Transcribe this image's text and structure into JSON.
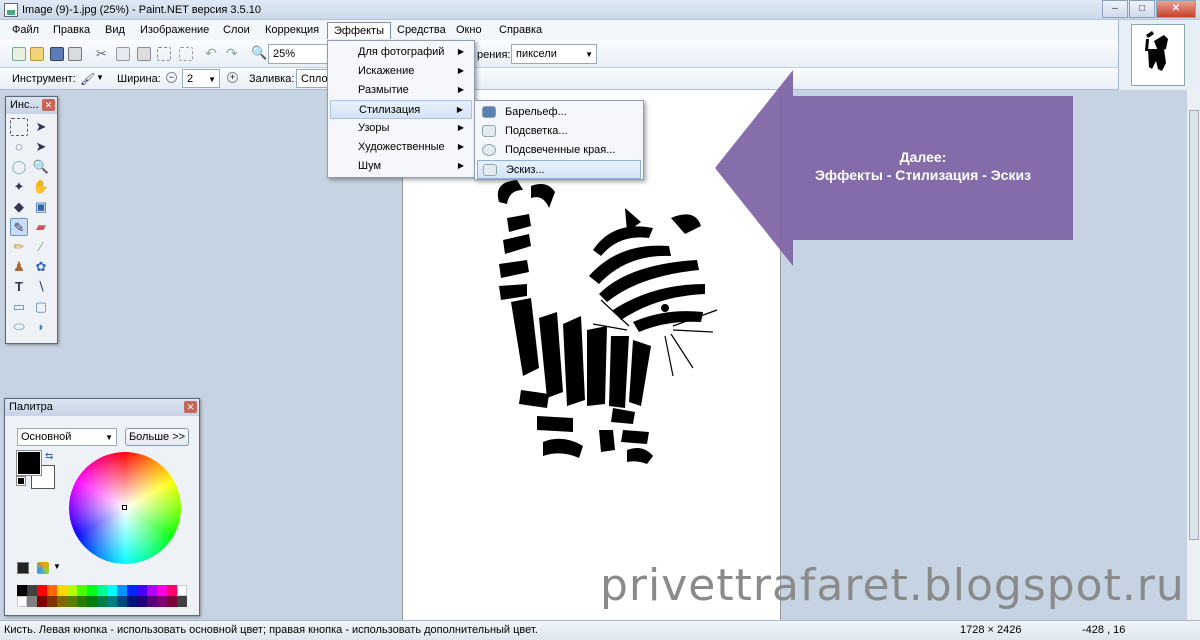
{
  "window": {
    "title": "Image (9)-1.jpg (25%) - Paint.NET версия 3.5.10",
    "min": "–",
    "max": "□",
    "close": "✕"
  },
  "menubar": [
    {
      "label": "Файл"
    },
    {
      "label": "Правка"
    },
    {
      "label": "Вид"
    },
    {
      "label": "Изображение"
    },
    {
      "label": "Слои"
    },
    {
      "label": "Коррекция"
    },
    {
      "label": "Эффекты"
    },
    {
      "label": "Средства"
    },
    {
      "label": "Окно"
    },
    {
      "label": "Справка"
    }
  ],
  "toolbar": {
    "zoom_value": "25%",
    "units_label": "рения:",
    "units_value": "пиксели",
    "tool_label": "Инструмент:",
    "width_label": "Ширина:",
    "width_value": "2",
    "fill_label": "Заливка:",
    "fill_value": "Спло"
  },
  "effects_menu": {
    "items": [
      {
        "label": "Для фотографий"
      },
      {
        "label": "Искажение"
      },
      {
        "label": "Размытие"
      },
      {
        "label": "Стилизация"
      },
      {
        "label": "Узоры"
      },
      {
        "label": "Художественные"
      },
      {
        "label": "Шум"
      }
    ],
    "highlighted": "Стилизация"
  },
  "stylize_submenu": {
    "items": [
      {
        "label": "Барельеф..."
      },
      {
        "label": "Подсветка..."
      },
      {
        "label": "Подсвеченные края..."
      },
      {
        "label": "Эскиз..."
      }
    ],
    "highlighted": "Эскиз..."
  },
  "tools_panel": {
    "title": "Инс..."
  },
  "palette_panel": {
    "title": "Палитра",
    "mode": "Основной",
    "more_button": "Больше >>",
    "primary_color": "#000000",
    "secondary_color": "#ffffff"
  },
  "callout": {
    "line1": "Далее:",
    "line2": "Эффекты - Стилизация - Эскиз",
    "color": "#7d63a4"
  },
  "watermark": "privettrafaret.blogspot.ru",
  "status": {
    "hint": "Кисть. Левая кнопка - использовать основной цвет; правая кнопка - использовать дополнительный цвет.",
    "image_size": "1728 × 2426",
    "cursor_pos": "-428 , 16"
  }
}
